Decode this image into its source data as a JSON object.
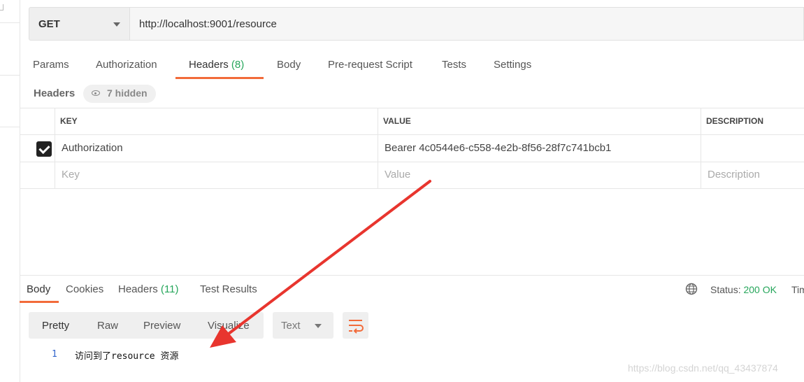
{
  "request": {
    "method": "GET",
    "url": "http://localhost:9001/resource"
  },
  "request_tabs": [
    {
      "label": "Params"
    },
    {
      "label": "Authorization"
    },
    {
      "label": "Headers",
      "count": "(8)"
    },
    {
      "label": "Body"
    },
    {
      "label": "Pre-request Script"
    },
    {
      "label": "Tests"
    },
    {
      "label": "Settings"
    }
  ],
  "headers_section": {
    "title": "Headers",
    "hidden_label": "7 hidden"
  },
  "headers_table": {
    "columns": [
      "KEY",
      "VALUE",
      "DESCRIPTION"
    ],
    "rows": [
      {
        "checked": true,
        "key": "Authorization",
        "value": "Bearer 4c0544e6-c558-4e2b-8f56-28f7c741bcb1",
        "description": ""
      }
    ],
    "placeholders": {
      "key": "Key",
      "value": "Value",
      "description": "Description"
    }
  },
  "response_tabs": [
    {
      "label": "Body"
    },
    {
      "label": "Cookies"
    },
    {
      "label": "Headers",
      "count": "(11)"
    },
    {
      "label": "Test Results"
    }
  ],
  "response_status": {
    "label": "Status:",
    "value": "200 OK",
    "time_label": "Tim"
  },
  "view_options": [
    "Pretty",
    "Raw",
    "Preview",
    "Visualize"
  ],
  "format": "Text",
  "response_body": {
    "line_number": "1",
    "content": "访问到了resource 资源"
  },
  "watermark": "https://blog.csdn.net/qq_43437874",
  "colors": {
    "accent": "#f26b3a",
    "success": "#26a65b",
    "annotation_arrow": "#e8352e"
  },
  "icons": [
    "chevron-down-icon",
    "eye-icon",
    "checkbox-checked-icon",
    "globe-icon",
    "wrap-lines-icon"
  ]
}
